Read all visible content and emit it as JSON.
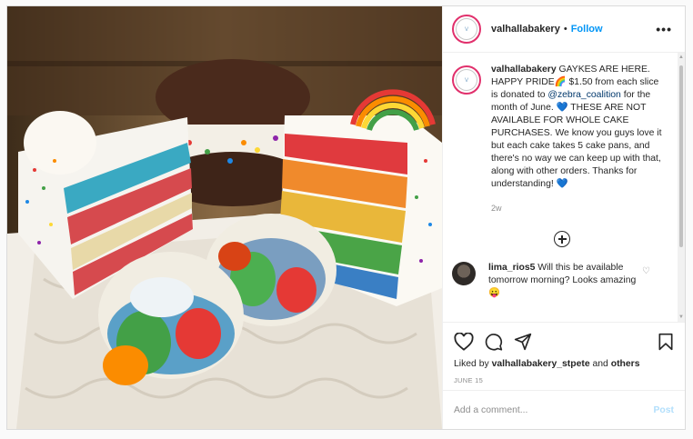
{
  "post": {
    "username": "valhallabakery",
    "dot": "•",
    "follow_label": "Follow",
    "more_label": "•••",
    "avatar_text": "VALHALLA"
  },
  "caption": {
    "username": "valhallabakery",
    "text_1": " GAYKES ARE HERE. HAPPY PRIDE",
    "emoji_rainbow": "🌈",
    "text_2": " $1.50 from each slice is donated to ",
    "mention": "@zebra_coalition",
    "text_3": " for the month of June. ",
    "emoji_heart_1": "💙",
    "text_4": " THESE ARE NOT AVAILABLE FOR WHOLE CAKE PURCHASES. We know you guys love it but each cake takes 5 cake pans, and there's no way we can keep up with that, along with other orders. Thanks for understanding! ",
    "emoji_heart_2": "💙",
    "age": "2w"
  },
  "comment": {
    "username": "lima_rios5",
    "text": " Will this be available tomorrow morning? Looks amazing ",
    "emoji": "😛"
  },
  "actions": {
    "likes_prefix": "Liked by ",
    "likes_user": "valhallabakery_stpete",
    "likes_suffix": " and ",
    "likes_others": "others",
    "date": "JUNE 15"
  },
  "add_comment": {
    "placeholder": "Add a comment...",
    "post_label": "Post"
  },
  "scroll": {
    "up": "▲",
    "down": "▼"
  },
  "icons": [
    "heart-icon",
    "comment-icon",
    "share-icon",
    "bookmark-icon",
    "plus-circle-icon",
    "small-heart-icon"
  ],
  "colors": {
    "follow": "#0095f6",
    "post_disabled": "#b2dffc",
    "mention": "#00376b"
  }
}
